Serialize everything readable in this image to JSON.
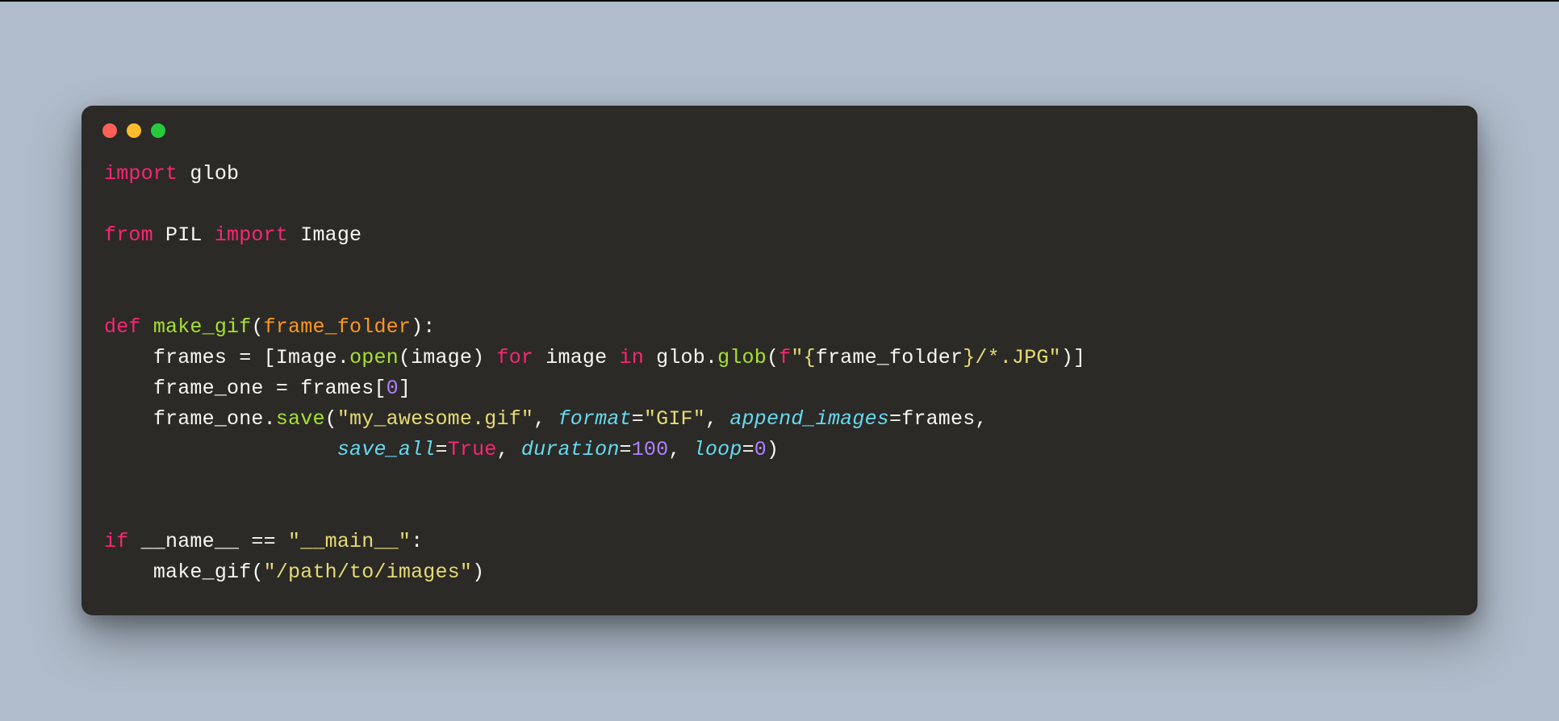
{
  "window": {
    "dots": [
      "red",
      "yellow",
      "green"
    ]
  },
  "code": {
    "line1": {
      "import": "import",
      "mod": "glob"
    },
    "line2": {
      "from": "from",
      "pkg": "PIL",
      "import": "import",
      "mod": "Image"
    },
    "line3": {
      "def": "def",
      "fn": "make_gif",
      "lparen": "(",
      "param": "frame_folder",
      "rparen": ")",
      "colon": ":"
    },
    "line4": {
      "indent": "    ",
      "lhs": "frames = [Image.",
      "open": "open",
      "open_arg": "(image) ",
      "for": "for",
      "mid1": " image ",
      "in": "in",
      "mid2": " glob.",
      "glob": "glob",
      "glob_l": "(",
      "fprefix": "f",
      "str1": "\"",
      "interp_l": "{",
      "interp_expr": "frame_folder",
      "interp_r": "}",
      "str2": "/*.JPG\"",
      "glob_r": ")]"
    },
    "line5": {
      "indent": "    ",
      "text1": "frame_one = frames[",
      "zero": "0",
      "text2": "]"
    },
    "line6": {
      "indent": "    ",
      "obj": "frame_one.",
      "save": "save",
      "lparen": "(",
      "str_gif": "\"my_awesome.gif\"",
      "c1": ", ",
      "k_format": "format",
      "eq1": "=",
      "str_fmt": "\"GIF\"",
      "c2": ", ",
      "k_append": "append_images",
      "eq2": "=frames,"
    },
    "line7": {
      "indent": "                   ",
      "k_saveall": "save_all",
      "eq1": "=",
      "true": "True",
      "c1": ", ",
      "k_duration": "duration",
      "eq2": "=",
      "n100": "100",
      "c2": ", ",
      "k_loop": "loop",
      "eq3": "=",
      "n0": "0",
      "rparen": ")"
    },
    "line8": {
      "if": "if",
      "sp": " ",
      "name": "__name__ == ",
      "str_main": "\"__main__\"",
      "colon": ":"
    },
    "line9": {
      "indent": "    ",
      "fn": "make_gif",
      "lparen": "(",
      "str_path": "\"/path/to/images\"",
      "rparen": ")"
    }
  }
}
